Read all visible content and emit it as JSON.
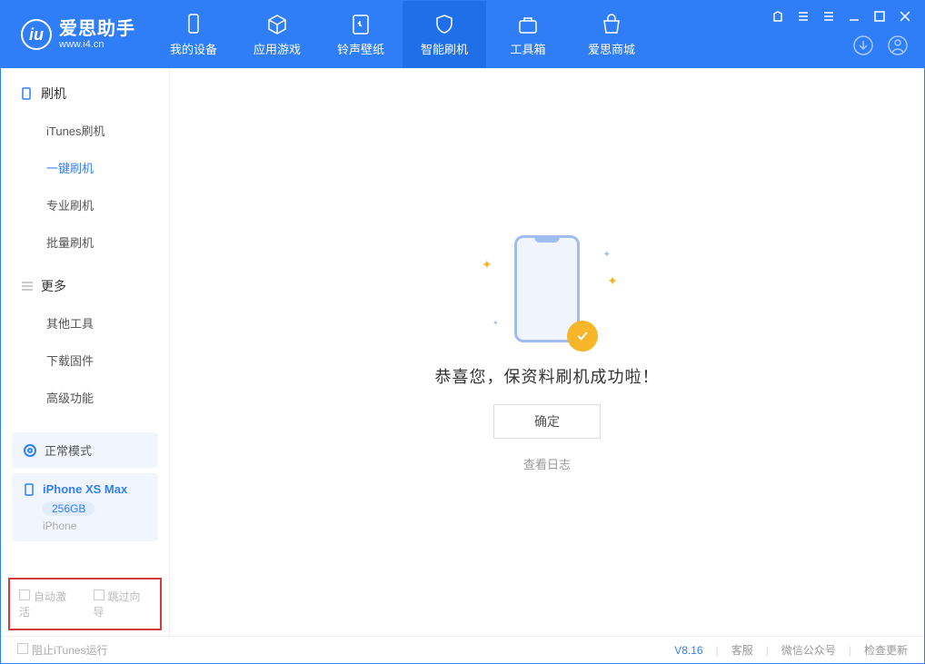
{
  "app": {
    "title": "爱思助手",
    "subtitle": "www.i4.cn"
  },
  "nav": {
    "items": [
      {
        "label": "我的设备"
      },
      {
        "label": "应用游戏"
      },
      {
        "label": "铃声壁纸"
      },
      {
        "label": "智能刷机"
      },
      {
        "label": "工具箱"
      },
      {
        "label": "爱思商城"
      }
    ]
  },
  "sidebar": {
    "section1_title": "刷机",
    "items1": [
      "iTunes刷机",
      "一键刷机",
      "专业刷机",
      "批量刷机"
    ],
    "section2_title": "更多",
    "items2": [
      "其他工具",
      "下载固件",
      "高级功能"
    ],
    "mode_label": "正常模式",
    "device_name": "iPhone XS Max",
    "device_cap": "256GB",
    "device_type": "iPhone",
    "cb1_label": "自动激活",
    "cb2_label": "跳过向导"
  },
  "main": {
    "success_text": "恭喜您，保资料刷机成功啦！",
    "ok_label": "确定",
    "log_link": "查看日志"
  },
  "footer": {
    "block_itunes": "阻止iTunes运行",
    "version": "V8.16",
    "links": [
      "客服",
      "微信公众号",
      "检查更新"
    ]
  }
}
